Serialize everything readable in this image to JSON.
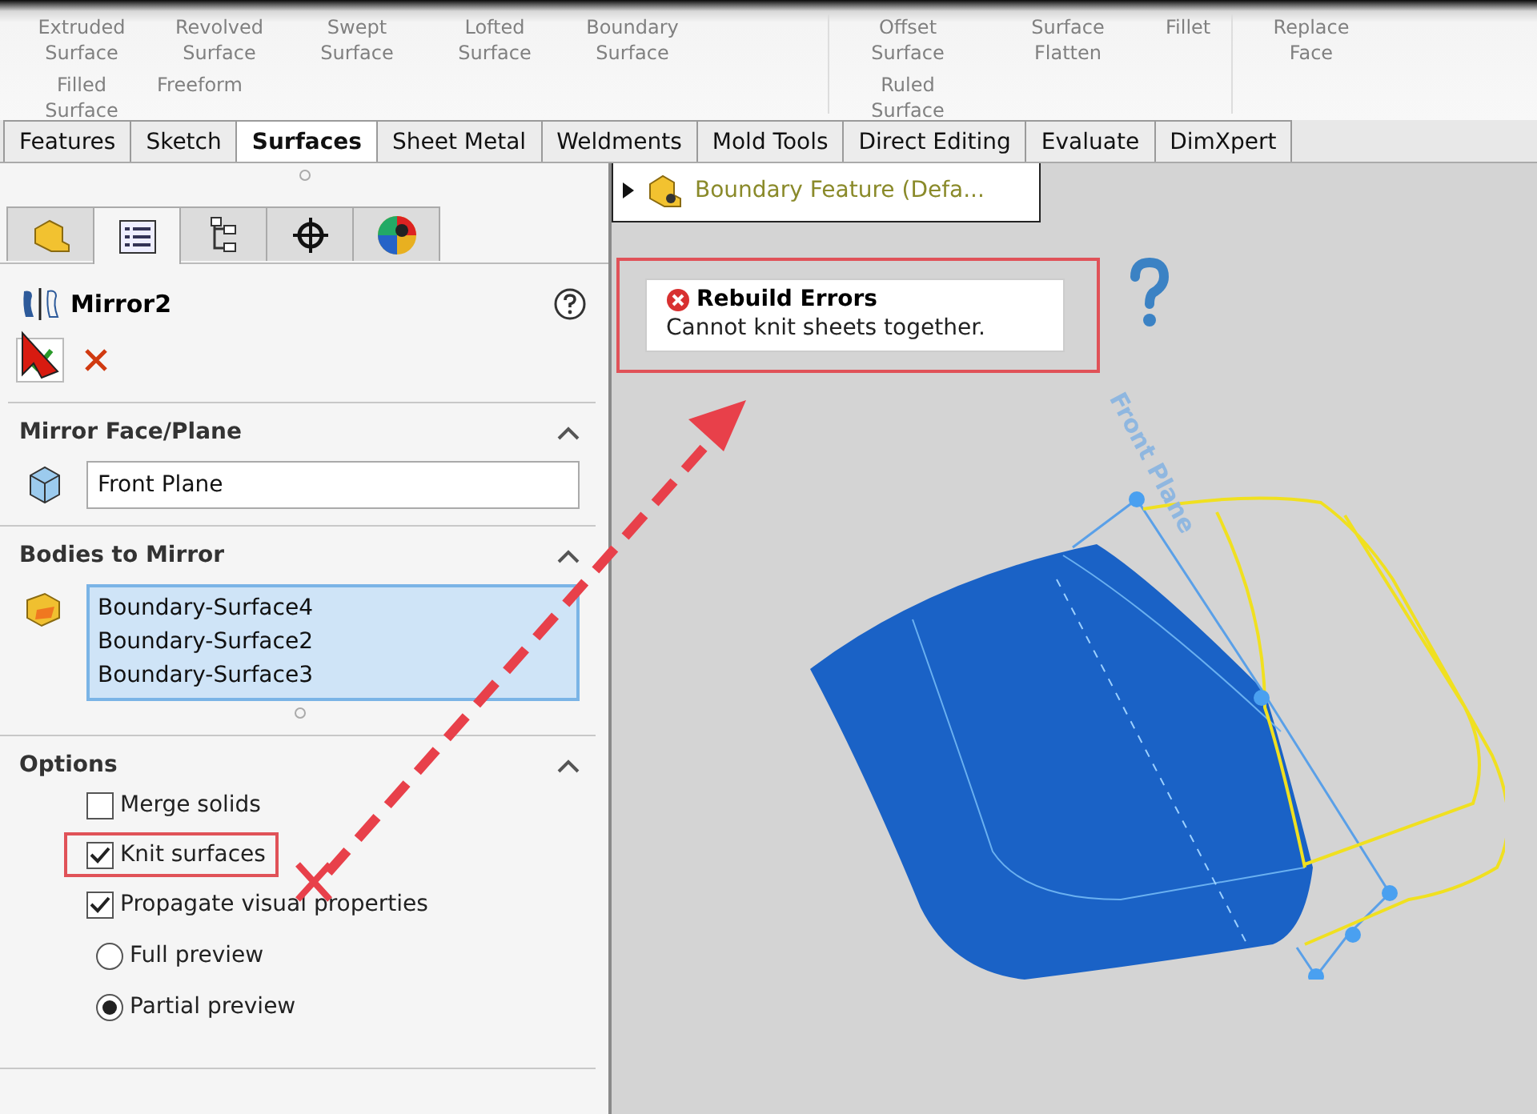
{
  "ribbon": {
    "groups": [
      [
        "Extruded Surface",
        "Revolved Surface",
        "Swept Surface",
        "Lofted Surface",
        "Boundary Surface",
        "Filled Surface",
        "Freeform"
      ],
      [
        "Offset Surface",
        "Surface Flatten",
        "Fillet",
        "Ruled Surface"
      ],
      [
        "Replace Face"
      ]
    ]
  },
  "tabs": [
    {
      "label": "Features",
      "selected": false
    },
    {
      "label": "Sketch",
      "selected": false
    },
    {
      "label": "Surfaces",
      "selected": true
    },
    {
      "label": "Sheet Metal",
      "selected": false
    },
    {
      "label": "Weldments",
      "selected": false
    },
    {
      "label": "Mold Tools",
      "selected": false
    },
    {
      "label": "Direct Editing",
      "selected": false
    },
    {
      "label": "Evaluate",
      "selected": false
    },
    {
      "label": "DimXpert",
      "selected": false
    }
  ],
  "panel_tabs": [
    {
      "kind": "feature",
      "selected": false
    },
    {
      "kind": "property",
      "selected": true
    },
    {
      "kind": "config",
      "selected": false
    },
    {
      "kind": "target",
      "selected": false
    },
    {
      "kind": "appearance",
      "selected": false
    }
  ],
  "property_manager": {
    "title": "Mirror2",
    "sections": [
      {
        "kind": "face",
        "title": "Mirror Face/Plane",
        "expanded": true,
        "value": "Front Plane"
      },
      {
        "kind": "bodies",
        "title": "Bodies to Mirror",
        "expanded": true,
        "items": [
          "Boundary-Surface4",
          "Boundary-Surface2",
          "Boundary-Surface3"
        ]
      },
      {
        "kind": "options",
        "title": "Options",
        "expanded": true,
        "options": [
          {
            "kind": "checkbox",
            "label": "Merge solids",
            "checked": false,
            "highlighted": false
          },
          {
            "kind": "checkbox",
            "label": "Knit surfaces",
            "checked": true,
            "highlighted": true
          },
          {
            "kind": "checkbox",
            "label": "Propagate visual properties",
            "checked": true,
            "highlighted": false
          },
          {
            "kind": "radio",
            "label": "Full preview",
            "selected": false,
            "highlighted": false
          },
          {
            "kind": "radio",
            "label": "Partial preview",
            "selected": true,
            "highlighted": false
          }
        ]
      }
    ]
  },
  "viewport": {
    "tree_item": "Boundary Feature  (Defa...",
    "error": {
      "title": "Rebuild Errors",
      "message": "Cannot knit sheets together.",
      "highlighted": true
    },
    "plane_label": "Front Plane"
  }
}
